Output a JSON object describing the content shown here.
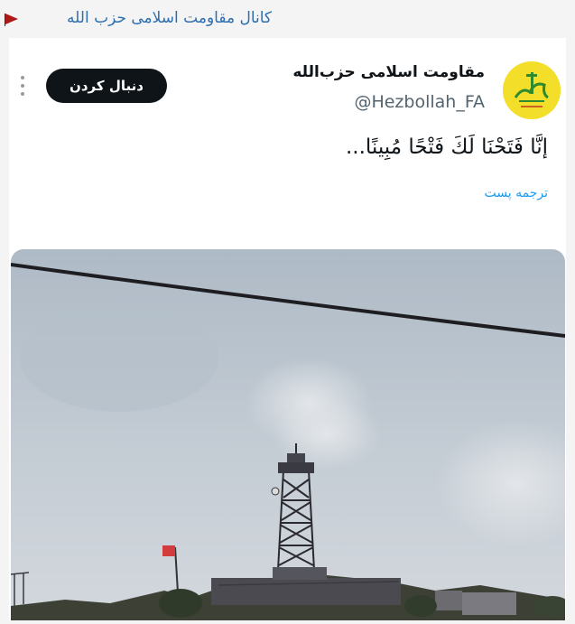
{
  "channel": {
    "title": "کانال مقاومت اسلامی حزب الله"
  },
  "tweet": {
    "display_name": "مقاومت اسلامی حزب‌الله",
    "handle": "@Hezbollah_FA",
    "follow_label": "دنبال کردن",
    "text": "إنَّا فَتَحْنَا لَكَ فَتْحًا مُبِينًا...",
    "translate_label": "ترجمه پست"
  },
  "colors": {
    "link": "#1d9bf0",
    "channel_link": "#2f6fb0",
    "follow_bg": "#0f1419",
    "avatar_bg": "#f3df2a",
    "flag": "#b01818"
  },
  "icons": {
    "more": "more-vertical-icon",
    "channel": "flag-icon"
  }
}
